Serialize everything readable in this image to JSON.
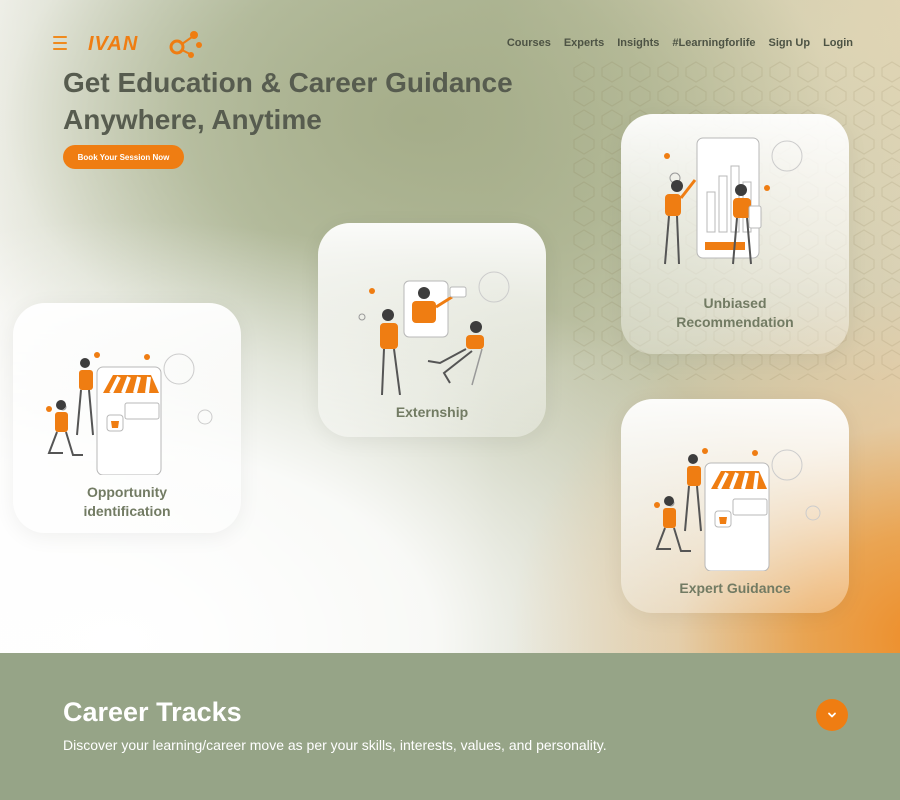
{
  "nav": {
    "logo_text": "IVAN",
    "links": [
      "Courses",
      "Experts",
      "Insights",
      "#Learningforlife",
      "Sign Up",
      "Login"
    ]
  },
  "hero": {
    "title_line1": "Get Education & Career Guidance",
    "title_line2": "Anywhere, Anytime",
    "cta_label": "Book Your Session Now"
  },
  "cards": [
    {
      "label_line1": "Opportunity",
      "label_line2": "identification",
      "illustration": "shop-illustration-icon"
    },
    {
      "label_line1": "Externship",
      "label_line2": "",
      "illustration": "meeting-illustration-icon"
    },
    {
      "label_line1": "Unbiased",
      "label_line2": "Recommendation",
      "illustration": "chart-illustration-icon"
    },
    {
      "label_line1": "Expert Guidance",
      "label_line2": "",
      "illustration": "shop-illustration-icon"
    }
  ],
  "tracks": {
    "title": "Career Tracks",
    "description": "Discover your learning/career move as per your skills, interests, values, and personality.",
    "toggle_icon": "chevron-down-icon"
  },
  "colors": {
    "accent": "#ef7d12",
    "text": "#575c4f",
    "band": "#96a487",
    "card_text": "#727b63"
  }
}
